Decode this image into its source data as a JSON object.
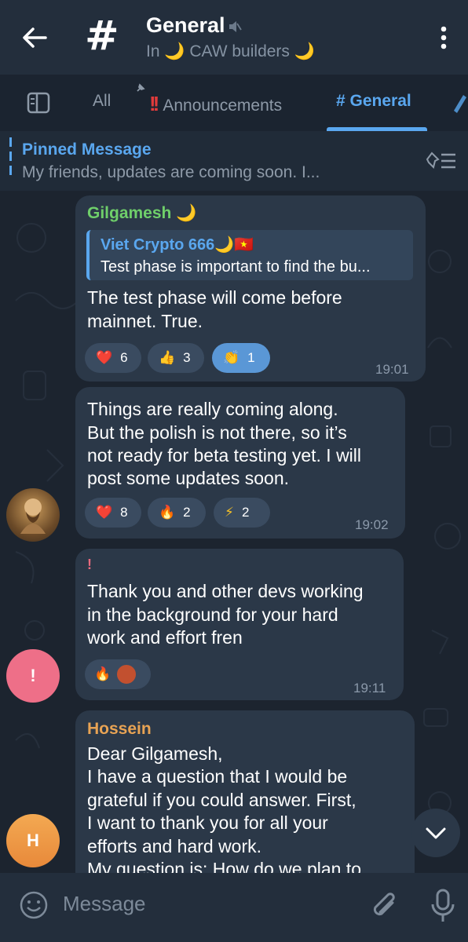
{
  "header": {
    "title": "General",
    "subtitle": "In 🌙 CAW builders 🌙"
  },
  "tabs": {
    "all": "All",
    "announcements": "Announcements",
    "general": "# General"
  },
  "pinned": {
    "title": "Pinned Message",
    "text": "My friends, updates are coming soon. I..."
  },
  "messages": [
    {
      "sender": "Gilgamesh 🌙",
      "reply_name": "Viet Crypto 666🌙🇻🇳",
      "reply_text": "Test phase is important to find the bu...",
      "lines": [
        "The test phase will come before",
        "mainnet. True."
      ],
      "reactions": [
        {
          "emoji": "❤️",
          "count": "6"
        },
        {
          "emoji": "👍",
          "count": "3"
        },
        {
          "emoji": "👏",
          "count": "1"
        }
      ],
      "time": "19:01"
    },
    {
      "lines": [
        "Things are really coming along.",
        "But the polish is not there, so it’s",
        "not ready for beta testing yet. I will",
        "post some updates soon."
      ],
      "reactions": [
        {
          "emoji": "❤️",
          "count": "8"
        },
        {
          "emoji": "🔥",
          "count": "2"
        },
        {
          "emoji": "⚡",
          "count": "2"
        }
      ],
      "time": "19:02"
    },
    {
      "sender": "!",
      "lines": [
        "Thank you and other devs working",
        "in the background for your hard",
        "work and effort fren"
      ],
      "reactions": [
        {
          "emoji": "🔥"
        }
      ],
      "time": "19:11",
      "avatar_letter": "!"
    },
    {
      "sender": "Hossein",
      "lines": [
        "Dear Gilgamesh,",
        "I have a question that I would be",
        "grateful if you could answer. First,",
        "I want to thank you for all your",
        "efforts and hard work.",
        "My question is: How do we plan to"
      ],
      "avatar_letter": "H"
    }
  ],
  "input": {
    "placeholder": "Message"
  },
  "colors": {
    "accent": "#5aa7ef",
    "bubble": "#2b3848",
    "gilgamesh_name": "#6fcf6a",
    "hossein_name": "#e8a354",
    "excl_name": "#e86a7e"
  }
}
